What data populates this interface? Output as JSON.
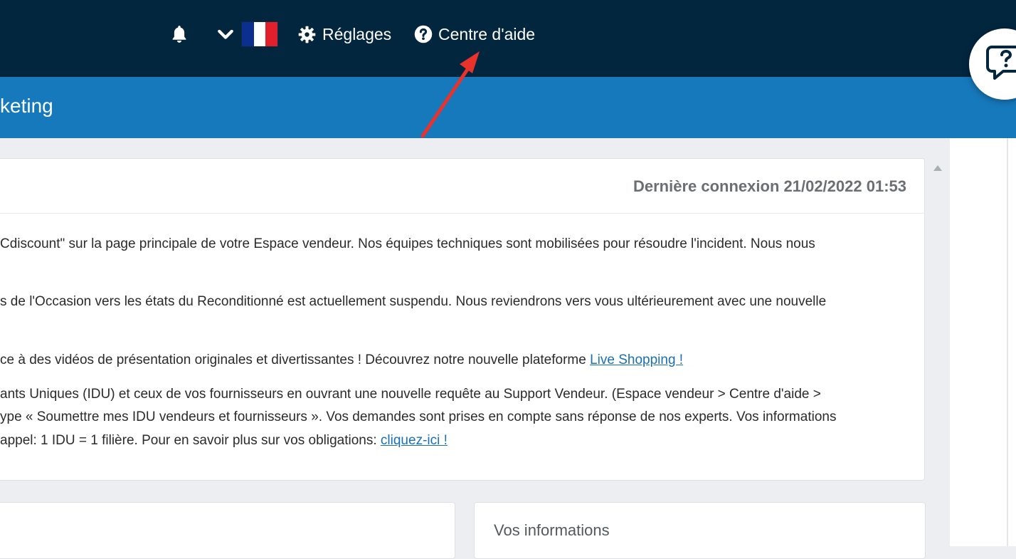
{
  "topbar": {
    "settings_label": "Réglages",
    "help_label": "Centre d'aide",
    "icons": [
      "bell-icon",
      "chevron-down-icon",
      "france-flag-icon",
      "gear-icon",
      "question-circle-icon"
    ],
    "background": "#03263f"
  },
  "flag_colors": [
    "#0c2f8f",
    "#ffffff",
    "#e0212c"
  ],
  "subbar": {
    "title": "keting",
    "background": "#1679bc"
  },
  "annotation": {
    "color": "#e8322b"
  },
  "panel": {
    "last_login": "Dernière connexion 21/02/2022 01:53",
    "messages": [
      "Cdiscount\" sur la page principale de votre Espace vendeur. Nos équipes techniques sont mobilisées pour résoudre l'incident. Nous nous",
      "s de l'Occasion vers les états du Reconditionné est actuellement suspendu. Nous reviendrons vers vous ultérieurement avec une nouvelle",
      "ce à des vidéos de présentation originales et divertissantes ! Découvrez notre nouvelle plateforme ",
      "ants Uniques (IDU) et ceux de vos fournisseurs en ouvrant une nouvelle requête au Support Vendeur. (Espace vendeur > Centre d'aide >",
      "ype « Soumettre mes IDU vendeurs et fournisseurs ». Vos demandes sont prises en compte sans réponse de nos experts. Vos informations",
      "appel: 1 IDU = 1 filière. Pour en savoir plus sur vos obligations: "
    ],
    "live_shopping_link": "Live Shopping !",
    "obligations_link": "cliquez-ici !"
  },
  "cards": {
    "right_title": "Vos informations"
  }
}
